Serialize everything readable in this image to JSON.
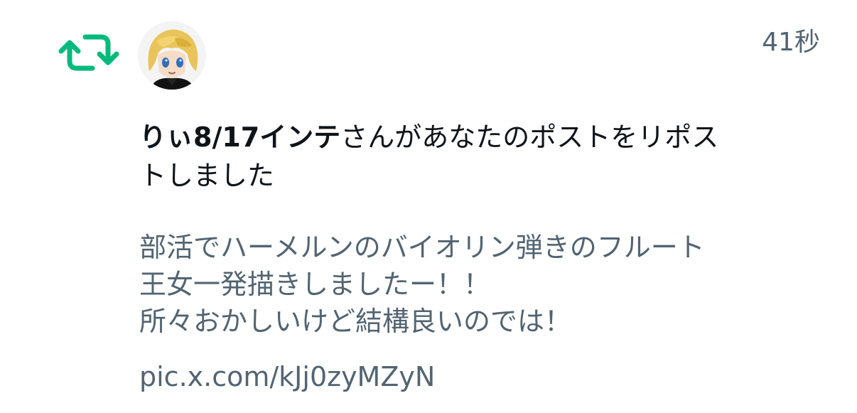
{
  "notification": {
    "icon": "repost-icon",
    "avatar": "user-avatar",
    "timestamp": "41秒",
    "username": "りぃ8/17インテ",
    "action_text": "さんがあなたのポストをリポストしました",
    "post_text": "部活でハーメルンのバイオリン弾きのフルート王女一発描きしましたー！！\n所々おかしいけど結構良いのでは！",
    "post_link": "pic.x.com/kJj0zyMZyN"
  },
  "colors": {
    "repost_green": "#00ba7c",
    "primary_text": "#0f1419",
    "secondary_text": "#536471",
    "background": "#ffffff"
  }
}
